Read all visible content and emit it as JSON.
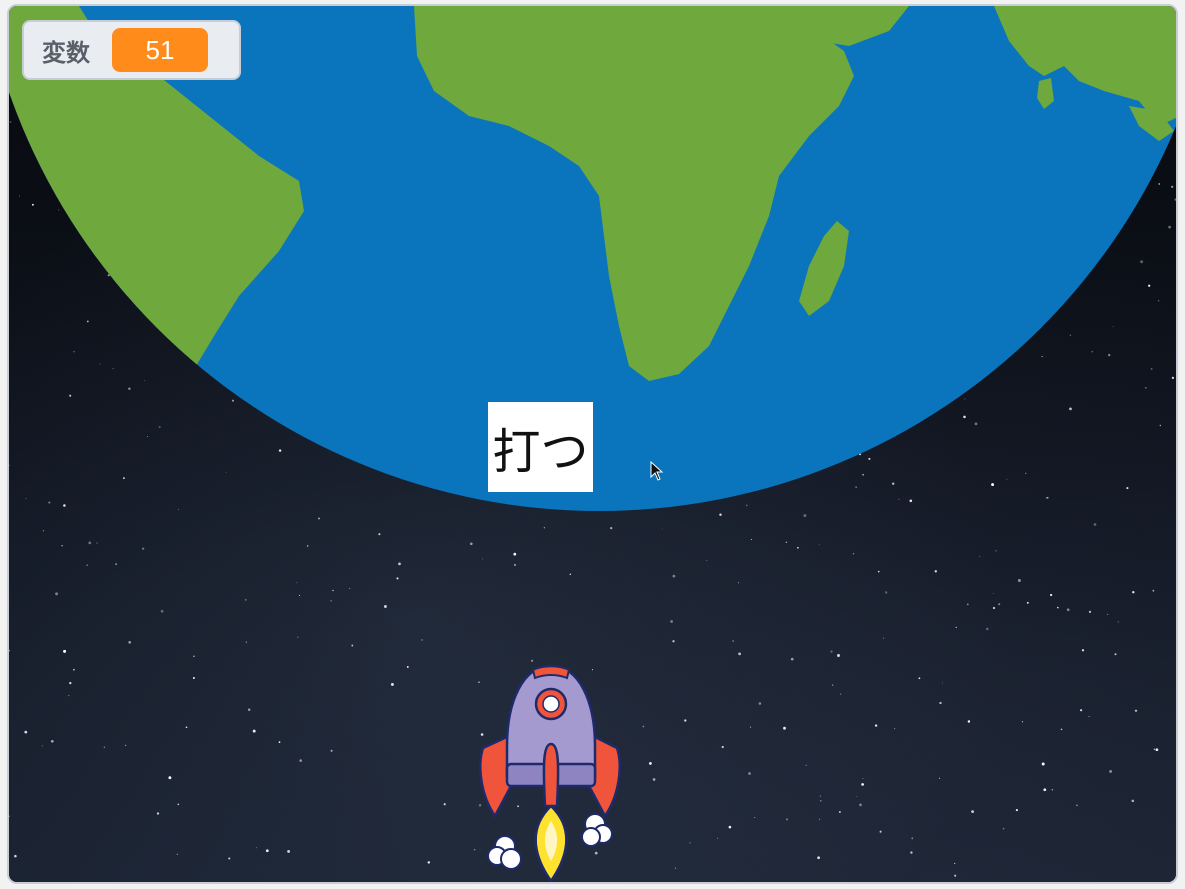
{
  "variable_monitor": {
    "label": "変数",
    "value": "51"
  },
  "shoot_button": {
    "label": "打つ"
  },
  "sprites": {
    "rocket": "rocket-sprite",
    "earth": "earth-backdrop"
  },
  "colors": {
    "ocean": "#0a75bd",
    "land": "#6fa83c",
    "variable_value_bg": "#ff8c1a",
    "space": "#0b0d12"
  }
}
